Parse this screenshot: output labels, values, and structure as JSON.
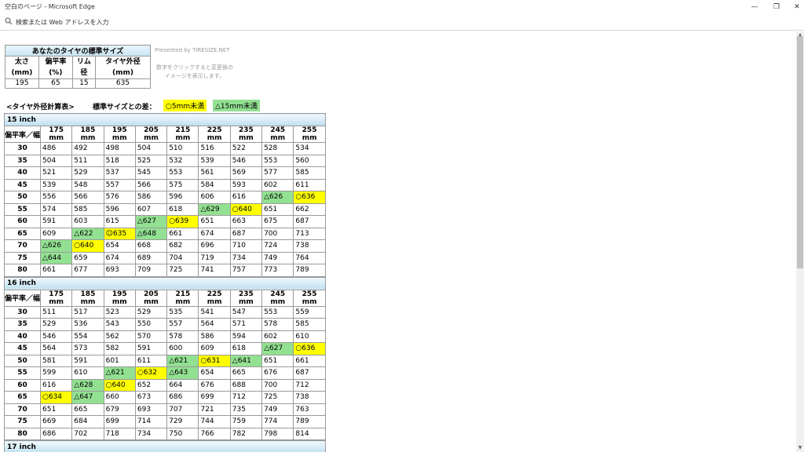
{
  "window": {
    "title": "空白のページ - Microsoft Edge",
    "minimize": "—",
    "maximize": "❐",
    "close": "✕"
  },
  "address": {
    "placeholder": "検索または Web アドレスを入力"
  },
  "standard": {
    "title": "あなたのタイヤの標準サイズ",
    "headers": [
      "太さ\n(mm)",
      "偏平率\n(%)",
      "リム\n径",
      "タイヤ外径\n(mm)"
    ],
    "values": [
      "195",
      "65",
      "15",
      "635"
    ]
  },
  "presented": "Presented by TIRESIZE.NET",
  "hint": "数字をクリックすると変更後のイメージを表示します。",
  "calc_title": "<タイヤ外径計算表>",
  "diff_label": "標準サイズとの差：",
  "legend": {
    "yellow": "○5mm未満",
    "green": "△15mm未満"
  },
  "colors": {
    "yellow": "#ffff00",
    "green": "#92e092",
    "header_blue": "#bfe0f0"
  },
  "corner_label": "偏平率／幅",
  "widths": [
    "175 mm",
    "185 mm",
    "195 mm",
    "205 mm",
    "215 mm",
    "225 mm",
    "235 mm",
    "245 mm",
    "255 mm"
  ],
  "sections": [
    {
      "title": "15 inch",
      "rows": [
        {
          "ratio": "30",
          "cells": [
            [
              "486",
              ""
            ],
            [
              "492",
              ""
            ],
            [
              "498",
              ""
            ],
            [
              "504",
              ""
            ],
            [
              "510",
              ""
            ],
            [
              "516",
              ""
            ],
            [
              "522",
              ""
            ],
            [
              "528",
              ""
            ],
            [
              "534",
              ""
            ]
          ]
        },
        {
          "ratio": "35",
          "cells": [
            [
              "504",
              ""
            ],
            [
              "511",
              ""
            ],
            [
              "518",
              ""
            ],
            [
              "525",
              ""
            ],
            [
              "532",
              ""
            ],
            [
              "539",
              ""
            ],
            [
              "546",
              ""
            ],
            [
              "553",
              ""
            ],
            [
              "560",
              ""
            ]
          ]
        },
        {
          "ratio": "40",
          "cells": [
            [
              "521",
              ""
            ],
            [
              "529",
              ""
            ],
            [
              "537",
              ""
            ],
            [
              "545",
              ""
            ],
            [
              "553",
              ""
            ],
            [
              "561",
              ""
            ],
            [
              "569",
              ""
            ],
            [
              "577",
              ""
            ],
            [
              "585",
              ""
            ]
          ]
        },
        {
          "ratio": "45",
          "cells": [
            [
              "539",
              ""
            ],
            [
              "548",
              ""
            ],
            [
              "557",
              ""
            ],
            [
              "566",
              ""
            ],
            [
              "575",
              ""
            ],
            [
              "584",
              ""
            ],
            [
              "593",
              ""
            ],
            [
              "602",
              ""
            ],
            [
              "611",
              ""
            ]
          ]
        },
        {
          "ratio": "50",
          "cells": [
            [
              "556",
              ""
            ],
            [
              "566",
              ""
            ],
            [
              "576",
              ""
            ],
            [
              "586",
              ""
            ],
            [
              "596",
              ""
            ],
            [
              "606",
              ""
            ],
            [
              "616",
              ""
            ],
            [
              "△626",
              "g"
            ],
            [
              "○636",
              "y"
            ]
          ]
        },
        {
          "ratio": "55",
          "cells": [
            [
              "574",
              ""
            ],
            [
              "585",
              ""
            ],
            [
              "596",
              ""
            ],
            [
              "607",
              ""
            ],
            [
              "618",
              ""
            ],
            [
              "△629",
              "g"
            ],
            [
              "○640",
              "y"
            ],
            [
              "651",
              ""
            ],
            [
              "662",
              ""
            ]
          ]
        },
        {
          "ratio": "60",
          "cells": [
            [
              "591",
              ""
            ],
            [
              "603",
              ""
            ],
            [
              "615",
              ""
            ],
            [
              "△627",
              "g"
            ],
            [
              "○639",
              "y"
            ],
            [
              "651",
              ""
            ],
            [
              "663",
              ""
            ],
            [
              "675",
              ""
            ],
            [
              "687",
              ""
            ]
          ]
        },
        {
          "ratio": "65",
          "cells": [
            [
              "609",
              ""
            ],
            [
              "△622",
              "g"
            ],
            [
              "☺635",
              "y"
            ],
            [
              "△648",
              "g"
            ],
            [
              "661",
              ""
            ],
            [
              "674",
              ""
            ],
            [
              "687",
              ""
            ],
            [
              "700",
              ""
            ],
            [
              "713",
              ""
            ]
          ]
        },
        {
          "ratio": "70",
          "cells": [
            [
              "△626",
              "g"
            ],
            [
              "○640",
              "y"
            ],
            [
              "654",
              ""
            ],
            [
              "668",
              ""
            ],
            [
              "682",
              ""
            ],
            [
              "696",
              ""
            ],
            [
              "710",
              ""
            ],
            [
              "724",
              ""
            ],
            [
              "738",
              ""
            ]
          ]
        },
        {
          "ratio": "75",
          "cells": [
            [
              "△644",
              "g"
            ],
            [
              "659",
              ""
            ],
            [
              "674",
              ""
            ],
            [
              "689",
              ""
            ],
            [
              "704",
              ""
            ],
            [
              "719",
              ""
            ],
            [
              "734",
              ""
            ],
            [
              "749",
              ""
            ],
            [
              "764",
              ""
            ]
          ]
        },
        {
          "ratio": "80",
          "cells": [
            [
              "661",
              ""
            ],
            [
              "677",
              ""
            ],
            [
              "693",
              ""
            ],
            [
              "709",
              ""
            ],
            [
              "725",
              ""
            ],
            [
              "741",
              ""
            ],
            [
              "757",
              ""
            ],
            [
              "773",
              ""
            ],
            [
              "789",
              ""
            ]
          ]
        }
      ]
    },
    {
      "title": "16 inch",
      "rows": [
        {
          "ratio": "30",
          "cells": [
            [
              "511",
              ""
            ],
            [
              "517",
              ""
            ],
            [
              "523",
              ""
            ],
            [
              "529",
              ""
            ],
            [
              "535",
              ""
            ],
            [
              "541",
              ""
            ],
            [
              "547",
              ""
            ],
            [
              "553",
              ""
            ],
            [
              "559",
              ""
            ]
          ]
        },
        {
          "ratio": "35",
          "cells": [
            [
              "529",
              ""
            ],
            [
              "536",
              ""
            ],
            [
              "543",
              ""
            ],
            [
              "550",
              ""
            ],
            [
              "557",
              ""
            ],
            [
              "564",
              ""
            ],
            [
              "571",
              ""
            ],
            [
              "578",
              ""
            ],
            [
              "585",
              ""
            ]
          ]
        },
        {
          "ratio": "40",
          "cells": [
            [
              "546",
              ""
            ],
            [
              "554",
              ""
            ],
            [
              "562",
              ""
            ],
            [
              "570",
              ""
            ],
            [
              "578",
              ""
            ],
            [
              "586",
              ""
            ],
            [
              "594",
              ""
            ],
            [
              "602",
              ""
            ],
            [
              "610",
              ""
            ]
          ]
        },
        {
          "ratio": "45",
          "cells": [
            [
              "564",
              ""
            ],
            [
              "573",
              ""
            ],
            [
              "582",
              ""
            ],
            [
              "591",
              ""
            ],
            [
              "600",
              ""
            ],
            [
              "609",
              ""
            ],
            [
              "618",
              ""
            ],
            [
              "△627",
              "g"
            ],
            [
              "○636",
              "y"
            ]
          ]
        },
        {
          "ratio": "50",
          "cells": [
            [
              "581",
              ""
            ],
            [
              "591",
              ""
            ],
            [
              "601",
              ""
            ],
            [
              "611",
              ""
            ],
            [
              "△621",
              "g"
            ],
            [
              "○631",
              "y"
            ],
            [
              "△641",
              "g"
            ],
            [
              "651",
              ""
            ],
            [
              "661",
              ""
            ]
          ]
        },
        {
          "ratio": "55",
          "cells": [
            [
              "599",
              ""
            ],
            [
              "610",
              ""
            ],
            [
              "△621",
              "g"
            ],
            [
              "○632",
              "y"
            ],
            [
              "△643",
              "g"
            ],
            [
              "654",
              ""
            ],
            [
              "665",
              ""
            ],
            [
              "676",
              ""
            ],
            [
              "687",
              ""
            ]
          ]
        },
        {
          "ratio": "60",
          "cells": [
            [
              "616",
              ""
            ],
            [
              "△628",
              "g"
            ],
            [
              "○640",
              "y"
            ],
            [
              "652",
              ""
            ],
            [
              "664",
              ""
            ],
            [
              "676",
              ""
            ],
            [
              "688",
              ""
            ],
            [
              "700",
              ""
            ],
            [
              "712",
              ""
            ]
          ]
        },
        {
          "ratio": "65",
          "cells": [
            [
              "○634",
              "y"
            ],
            [
              "△647",
              "g"
            ],
            [
              "660",
              ""
            ],
            [
              "673",
              ""
            ],
            [
              "686",
              ""
            ],
            [
              "699",
              ""
            ],
            [
              "712",
              ""
            ],
            [
              "725",
              ""
            ],
            [
              "738",
              ""
            ]
          ]
        },
        {
          "ratio": "70",
          "cells": [
            [
              "651",
              ""
            ],
            [
              "665",
              ""
            ],
            [
              "679",
              ""
            ],
            [
              "693",
              ""
            ],
            [
              "707",
              ""
            ],
            [
              "721",
              ""
            ],
            [
              "735",
              ""
            ],
            [
              "749",
              ""
            ],
            [
              "763",
              ""
            ]
          ]
        },
        {
          "ratio": "75",
          "cells": [
            [
              "669",
              ""
            ],
            [
              "684",
              ""
            ],
            [
              "699",
              ""
            ],
            [
              "714",
              ""
            ],
            [
              "729",
              ""
            ],
            [
              "744",
              ""
            ],
            [
              "759",
              ""
            ],
            [
              "774",
              ""
            ],
            [
              "789",
              ""
            ]
          ]
        },
        {
          "ratio": "80",
          "cells": [
            [
              "686",
              ""
            ],
            [
              "702",
              ""
            ],
            [
              "718",
              ""
            ],
            [
              "734",
              ""
            ],
            [
              "750",
              ""
            ],
            [
              "766",
              ""
            ],
            [
              "782",
              ""
            ],
            [
              "798",
              ""
            ],
            [
              "814",
              ""
            ]
          ]
        }
      ]
    },
    {
      "title": "17 inch",
      "rows": []
    }
  ]
}
